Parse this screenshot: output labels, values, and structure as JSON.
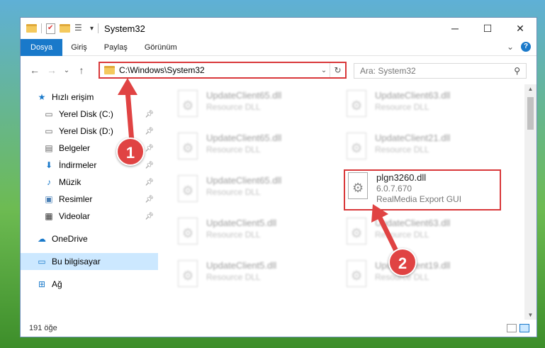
{
  "window": {
    "title": "System32",
    "controls": {
      "minimize": "─",
      "maximize": "☐",
      "close": "✕"
    }
  },
  "ribbon": {
    "tabs": [
      "Dosya",
      "Giriş",
      "Paylaş",
      "Görünüm"
    ],
    "expand_icon": "⌄",
    "help": "?"
  },
  "nav": {
    "back": "←",
    "forward": "→",
    "recent": "⌄",
    "up": "↑",
    "address": "C:\\Windows\\System32",
    "address_dropdown": "⌄",
    "refresh": "↻",
    "search_placeholder": "Ara: System32"
  },
  "sidebar": {
    "quick_access": "Hızlı erişim",
    "items": [
      {
        "label": "Yerel Disk (C:)",
        "icon": "drive-icon"
      },
      {
        "label": "Yerel Disk (D:)",
        "icon": "drive-icon"
      },
      {
        "label": "Belgeler",
        "icon": "documents-icon"
      },
      {
        "label": "İndirmeler",
        "icon": "download-icon"
      },
      {
        "label": "Müzik",
        "icon": "music-icon"
      },
      {
        "label": "Resimler",
        "icon": "pictures-icon"
      },
      {
        "label": "Videolar",
        "icon": "videos-icon"
      }
    ],
    "onedrive": "OneDrive",
    "this_pc": "Bu bilgisayar",
    "network": "Ağ"
  },
  "files": [
    {
      "name": "UpdateClient65.dll",
      "desc": "Resource DLL"
    },
    {
      "name": "UpdateClient63.dll",
      "desc": "Resource DLL"
    },
    {
      "name": "UpdateClient65.dll",
      "desc": "Resource DLL"
    },
    {
      "name": "UpdateClient21.dll",
      "desc": "Resource DLL"
    },
    {
      "name": "UpdateClient65.dll",
      "desc": "Resource DLL"
    },
    {
      "name": "plgn3260.dll",
      "version": "6.0.7.670",
      "desc": "RealMedia Export GUI"
    },
    {
      "name": "UpdateClient5.dll",
      "desc": "Resource DLL"
    },
    {
      "name": "UpdateClient63.dll",
      "desc": "Resource DLL"
    },
    {
      "name": "UpdateClient5.dll",
      "desc": "Resource DLL"
    },
    {
      "name": "UpdateClient19.dll",
      "desc": "Resource DLL"
    }
  ],
  "annotations": {
    "step1": "1",
    "step2": "2",
    "color": "#e04343"
  },
  "status": {
    "count": "191 öğe"
  }
}
